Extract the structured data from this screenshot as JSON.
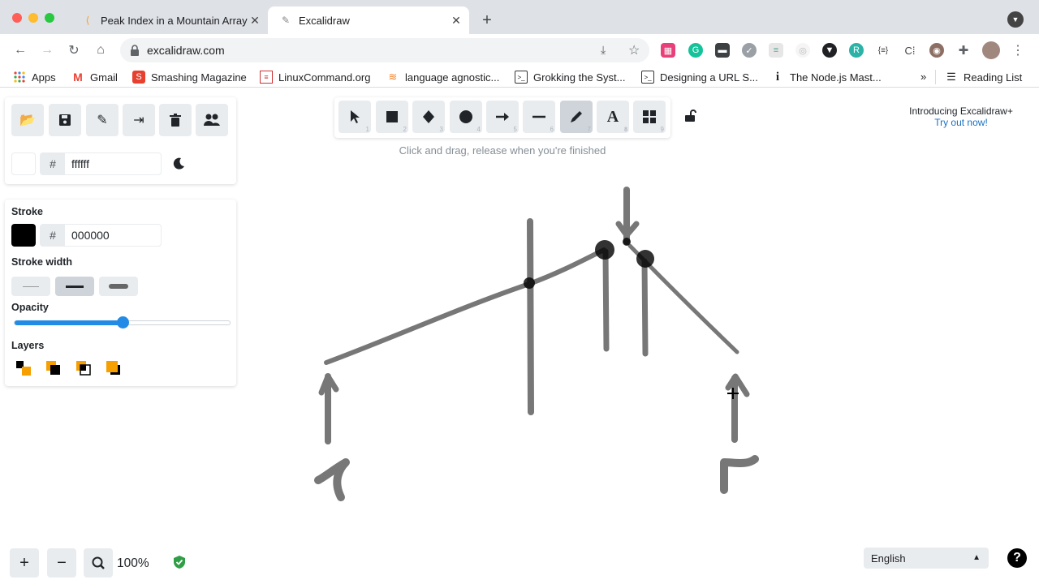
{
  "browser": {
    "tabs": [
      {
        "title": "Peak Index in a Mountain Array",
        "active": false
      },
      {
        "title": "Excalidraw",
        "active": true
      }
    ],
    "url": "excalidraw.com",
    "bookmarks": [
      "Apps",
      "Gmail",
      "Smashing Magazine",
      "LinuxCommand.org",
      "language agnostic...",
      "Grokking the Syst...",
      "Designing a URL S...",
      "The Node.js Mast..."
    ],
    "reading_list": "Reading List",
    "more_bookmarks": "»"
  },
  "canvas_panel": {
    "background_hex": "ffffff",
    "hash_symbol": "#"
  },
  "properties": {
    "stroke_label": "Stroke",
    "stroke_hex": "000000",
    "stroke_width_label": "Stroke width",
    "opacity_label": "Opacity",
    "opacity_value": 0.5,
    "layers_label": "Layers"
  },
  "toolbar": {
    "tools": [
      {
        "name": "selection",
        "num": "1"
      },
      {
        "name": "rectangle",
        "num": "2"
      },
      {
        "name": "diamond",
        "num": "3"
      },
      {
        "name": "ellipse",
        "num": "4"
      },
      {
        "name": "arrow",
        "num": "5"
      },
      {
        "name": "line",
        "num": "6"
      },
      {
        "name": "draw",
        "num": "7"
      },
      {
        "name": "text",
        "num": "8"
      },
      {
        "name": "library",
        "num": "9"
      }
    ],
    "active_tool": "draw",
    "hint": "Click and drag, release when you're finished"
  },
  "promo": {
    "line1": "Introducing Excalidraw+",
    "line2": "Try out now!"
  },
  "footer": {
    "zoom": "100%",
    "language": "English",
    "help": "?"
  },
  "colors": {
    "accent": "#228be6",
    "link": "#1971c2",
    "stroke": "#000000",
    "drawing_gray": "#777777",
    "shield_green": "#2f9e44"
  }
}
